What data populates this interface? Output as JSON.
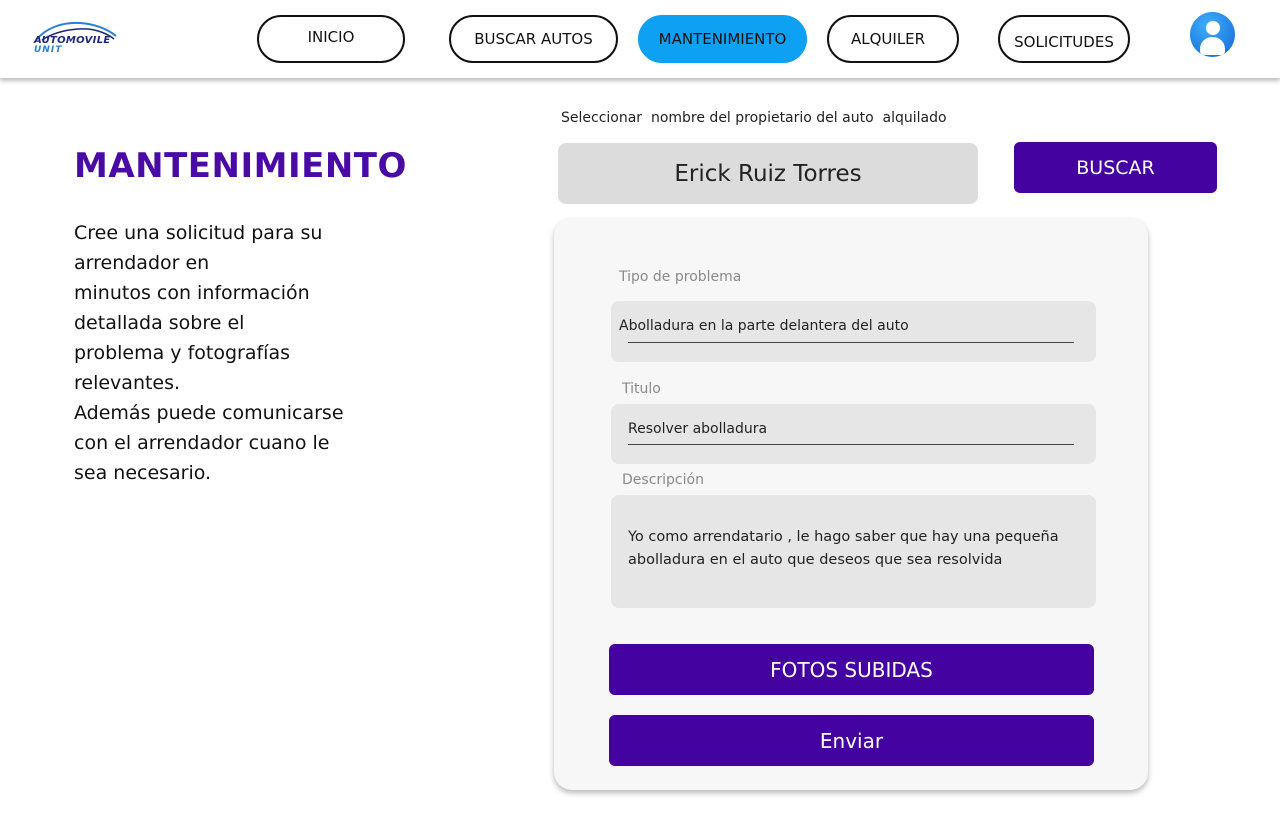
{
  "brand": {
    "line1": "AUTOMOVILE",
    "line2": "UNIT"
  },
  "nav": {
    "inicio": "INICIO",
    "buscar_autos": "BUSCAR AUTOS",
    "mantenimiento": "MANTENIMIENTO",
    "alquiler": "ALQUILER",
    "solicitudes": "SOLICITUDES",
    "active": "MANTENIMIENTO"
  },
  "colors": {
    "accent_purple": "#4402a0",
    "title_purple": "#4a0aa5",
    "active_nav_blue": "#0ea0f2",
    "avatar_blue": "#1a73d9"
  },
  "icons": {
    "avatar": "user-avatar-icon",
    "logo": "car-logo-icon"
  },
  "main": {
    "title": "MANTENIMIENTO",
    "intro": "Cree una solicitud para su\n arrendador en\nminutos con información\ndetallada sobre el\nproblema y fotografías\nrelevantes.\nAdemás puede comunicarse\ncon el arrendador cuano le\nsea necesario."
  },
  "owner": {
    "label": "Seleccionar  nombre del propietario del auto  alquilado",
    "selected": "Erick Ruiz Torres",
    "search_button": "BUSCAR"
  },
  "form": {
    "tipo_label": "Tipo de problema",
    "tipo_value": "Abolladura en la parte delantera del auto",
    "titulo_label": "Titulo",
    "titulo_value": "Resolver abolladura",
    "descripcion_label": "Descripción",
    "descripcion_value": "Yo como arrendatario , le hago saber que hay una pequeña abolladura en el auto que deseos que sea resolvida",
    "fotos_button": "FOTOS SUBIDAS",
    "enviar_button": "Enviar"
  }
}
